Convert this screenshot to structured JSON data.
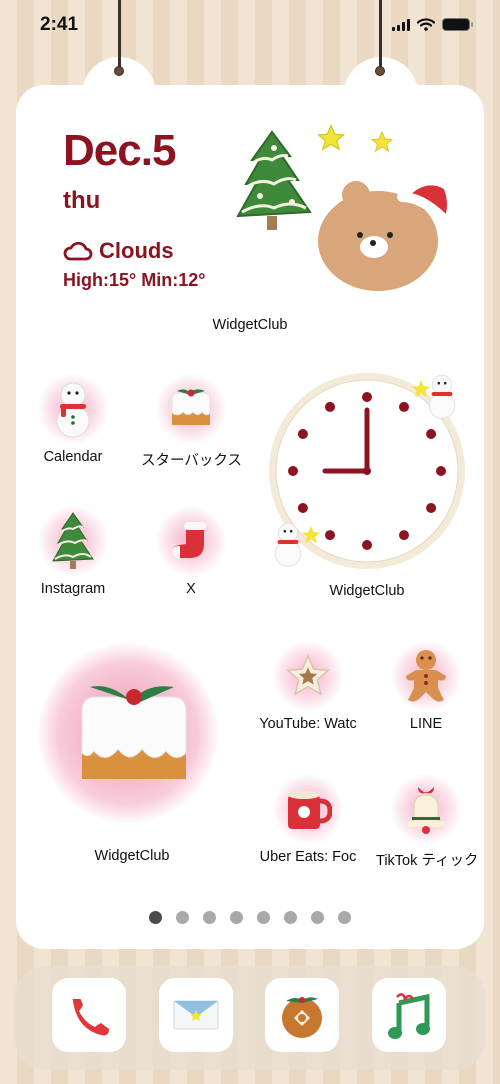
{
  "status_bar": {
    "time": "2:41"
  },
  "weather_widget": {
    "date": "Dec.5",
    "weekday": "thu",
    "condition": "Clouds",
    "temps": "High:15° Min:12°",
    "label": "WidgetClub"
  },
  "apps": [
    {
      "label": "Calendar",
      "icon": "snowman-icon"
    },
    {
      "label": "スターバックス",
      "icon": "christmas-cake-icon"
    },
    {
      "label": "Instagram",
      "icon": "christmas-tree-icon"
    },
    {
      "label": "X",
      "icon": "stocking-icon"
    },
    {
      "label": "YouTube: Watc",
      "icon": "star-cookie-icon"
    },
    {
      "label": "LINE",
      "icon": "gingerbread-man-icon"
    },
    {
      "label": "Uber Eats: Foc",
      "icon": "red-mug-icon"
    },
    {
      "label": "TikTok ティック",
      "icon": "bell-icon"
    }
  ],
  "clock_widget": {
    "label": "WidgetClub",
    "time": "9:00"
  },
  "photo_widget": {
    "label": "WidgetClub"
  },
  "page_dots": {
    "count": 8,
    "active": 0
  },
  "dock": [
    {
      "name": "phone",
      "icon": "phone-icon"
    },
    {
      "name": "mail",
      "icon": "mail-icon"
    },
    {
      "name": "browser",
      "icon": "donut-icon"
    },
    {
      "name": "music",
      "icon": "music-note-icon"
    }
  ],
  "colors": {
    "accent": "#8c1320",
    "background": "#f1e4d2"
  }
}
